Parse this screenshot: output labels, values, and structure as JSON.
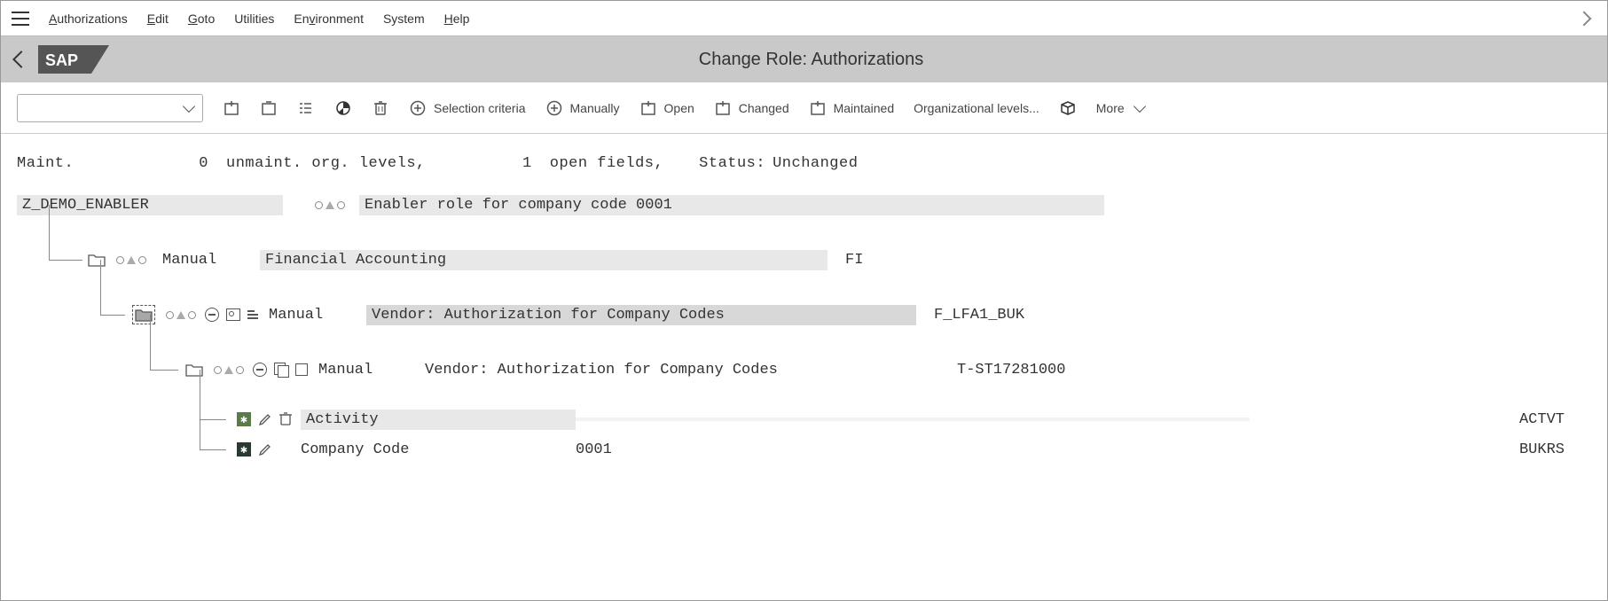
{
  "menu": {
    "authorizations": "Authorizations",
    "edit": "Edit",
    "goto": "Goto",
    "utilities": "Utilities",
    "environment": "Environment",
    "system": "System",
    "help": "Help"
  },
  "titlebar": {
    "title": "Change Role: Authorizations"
  },
  "toolbar": {
    "selection_criteria": "Selection criteria",
    "manually": "Manually",
    "open": "Open",
    "changed": "Changed",
    "maintained": "Maintained",
    "org_levels": "Organizational levels...",
    "more": "More"
  },
  "status": {
    "maint_label": "Maint.",
    "unmaint_count": "0",
    "unmaint_label": "unmaint. org. levels,",
    "open_count": "1",
    "open_label": "open fields,",
    "status_label": "Status:",
    "status_value": "Unchanged"
  },
  "tree": {
    "root": {
      "name": "Z_DEMO_ENABLER",
      "desc": "Enabler role for company code 0001"
    },
    "class": {
      "maint": "Manual",
      "desc": "Financial Accounting",
      "tech": "FI"
    },
    "object": {
      "maint": "Manual",
      "desc": "Vendor: Authorization for Company Codes",
      "tech": "F_LFA1_BUK"
    },
    "auth": {
      "maint": "Manual",
      "desc": "Vendor: Authorization for Company Codes",
      "tech": "T-ST17281000"
    },
    "fields": [
      {
        "label": "Activity",
        "value": "",
        "tech": "ACTVT"
      },
      {
        "label": "Company Code",
        "value": "0001",
        "tech": "BUKRS"
      }
    ]
  }
}
